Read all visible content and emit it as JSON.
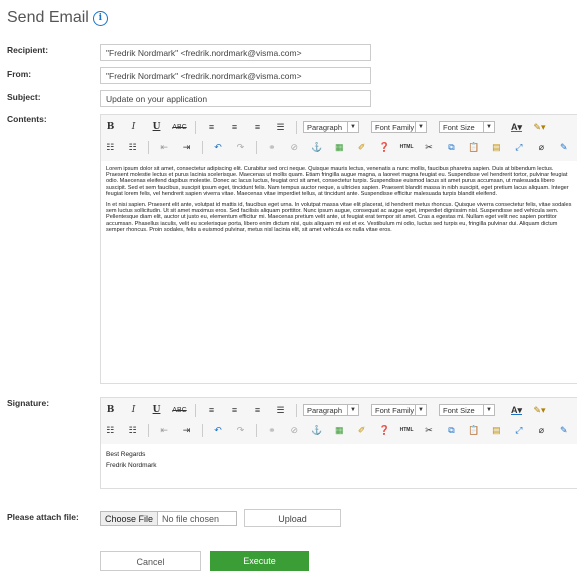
{
  "title": "Send Email",
  "labels": {
    "recipient": "Recipient:",
    "from": "From:",
    "subject": "Subject:",
    "contents": "Contents:",
    "signature": "Signature:",
    "attach": "Please attach file:"
  },
  "fields": {
    "recipient": "\"Fredrik Nordmark\" <fredrik.nordmark@visma.com>",
    "from": "\"Fredrik Nordmark\" <fredrik.nordmark@visma.com>",
    "subject": "Update on your application"
  },
  "toolbar": {
    "paragraph": "Paragraph",
    "font_family": "Font Family",
    "font_size": "Font Size",
    "html": "HTML"
  },
  "contents": {
    "p1": "Lorem ipsum dolor sit amet, consectetur adipiscing elit. Curabitur sed orci neque. Quisque mauris lectus, venenatis a nunc mollis, faucibus pharetra sapien. Duis at bibendum lectus. Praesent molestie lectus et purus lacinia scelerisque. Maecenas ut mollis quam. Etiam fringilla augue magna, a laoreet magna feugiat eu. Suspendisse vel hendrerit tortor, pulvinar feugiat odio. Maecenas eleifend dapibus molestie. Donec ac lacus luctus, feugiat orci sit amet, consectetur turpis. Suspendisse euismod lacus sit amet purus accumsan, ut malesuada libero suscipit. Sed et sem faucibus, suscipit ipsum eget, tincidunt felis. Nam tempus auctor neque, a ultricies sapien. Praesent blandit massa in nibh suscipit, eget pretium lacus aliquam. Integer feugiat lorem felis, vel hendrerit sapien viverra vitae. Maecenas vitae imperdiet tellus, at tincidunt ante. Suspendisse efficitur malesuada turpis blandit eleifend.",
    "p2": "In et nisi sapien. Praesent elit ante, volutpat id mattis id, faucibus eget urna. In volutpat massa vitae elit placerat, id hendrerit metus rhoncus. Quisque viverra consectetur felis, vitae sodales sem luctus sollicitudin. Ut sit amet maximus eros. Sed facilisis aliquam porttitor. Nunc ipsum augue, consequat ac augue eget, imperdiet dignissim nisl. Suspendisse sed vehicula sem. Pellentesque diam elit, auctor ut justo eu, elementum efficitur mi. Maecenas pretium velit ante, ut feugiat erat tempor sit amet. Cras a egestas mi. Nullam eget velit nec sapien porttitor accumsan. Phasellus iaculis, velit eu scelerisque porta, libero enim dictum nisi, quis aliquam mi est et ex. Vestibulum mi odio, luctus sed turpis eu, fringilla pulvinar dui. Aliquam dictum semper rhoncus. Proin sodales, felis a euismod pulvinar, metus nisl lacinia elit, sit amet vehicula ex nulla vitae eros."
  },
  "signature": {
    "line1": "Best Regards",
    "line2": "Fredrik Nordmark"
  },
  "file": {
    "choose": "Choose File",
    "status": "No file chosen",
    "upload": "Upload"
  },
  "actions": {
    "cancel": "Cancel",
    "execute": "Execute"
  },
  "colors": {
    "accent": "#1a73c8",
    "execute": "#3a9d35"
  }
}
